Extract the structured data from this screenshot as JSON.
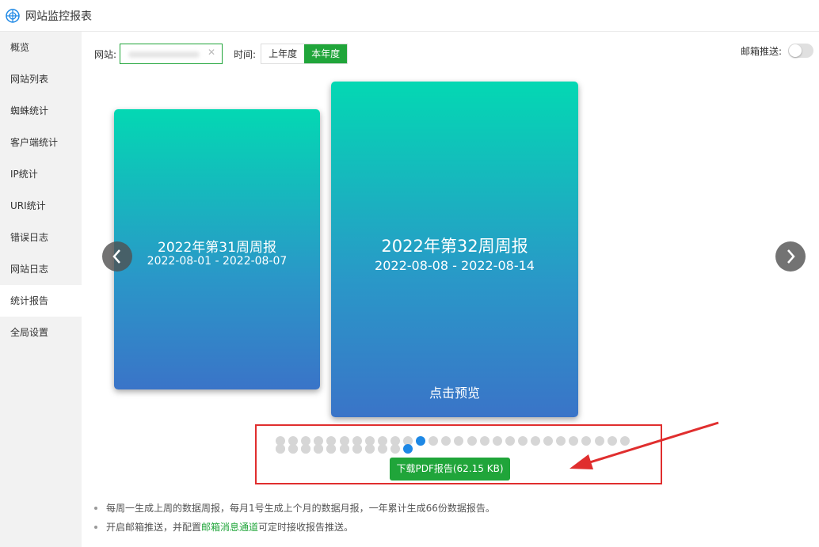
{
  "app": {
    "title": "网站监控报表"
  },
  "sidebar": {
    "items": [
      {
        "label": "概览"
      },
      {
        "label": "网站列表"
      },
      {
        "label": "蜘蛛统计"
      },
      {
        "label": "客户端统计"
      },
      {
        "label": "IP统计"
      },
      {
        "label": "URI统计"
      },
      {
        "label": "错误日志"
      },
      {
        "label": "网站日志"
      },
      {
        "label": "统计报告"
      },
      {
        "label": "全局设置"
      }
    ],
    "active_index": 8
  },
  "toolbar": {
    "site_label": "网站:",
    "time_label": "时间:",
    "time_options": [
      "上年度",
      "本年度"
    ],
    "time_selected": "本年度",
    "mail_label": "邮箱推送:",
    "mail_push_enabled": false
  },
  "carousel": {
    "prev_card": {
      "title": "2022年第31周周报",
      "range": "2022-08-01 - 2022-08-07"
    },
    "current_card": {
      "title": "2022年第32周周报",
      "range": "2022-08-08 - 2022-08-14",
      "preview_label": "点击预览"
    },
    "pagination": {
      "total": 36,
      "active_index": 11
    }
  },
  "download_button": {
    "label": "下载PDF报告(62.15 KB)"
  },
  "notes": {
    "line1": "每周一生成上周的数据周报，每月1号生成上个月的数据月报，一年累计生成66份数据报告。",
    "line2_pre": "开启邮箱推送，并配置",
    "line2_link": "邮箱消息通道",
    "line2_post": "可定时接收报告推送。"
  },
  "colors": {
    "accent": "#20a53a",
    "highlight_box": "#e02e2e",
    "active_dot": "#1e88e5"
  }
}
